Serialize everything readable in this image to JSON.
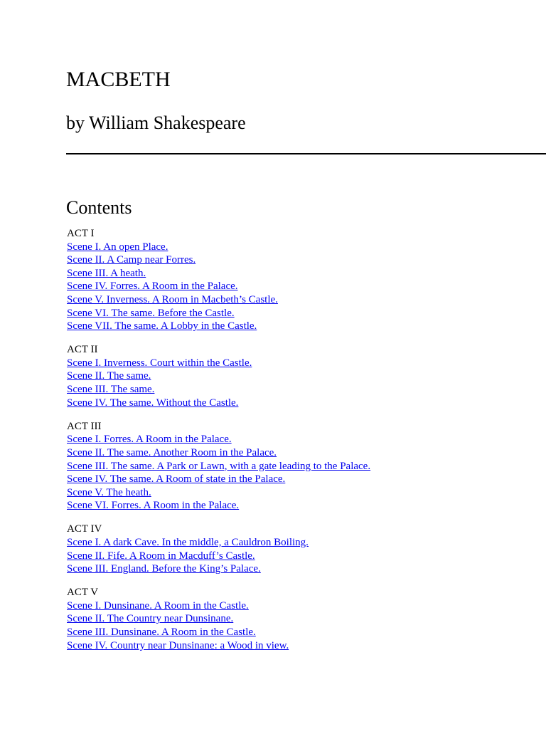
{
  "title": "MACBETH",
  "author": "by William Shakespeare",
  "contents_heading": "Contents",
  "link_color": "#0000ee",
  "acts": [
    {
      "label": "ACT I",
      "scenes": [
        "Scene I. An open Place.",
        "Scene II. A Camp near Forres.",
        "Scene III. A heath.",
        "Scene IV. Forres. A Room in the Palace.",
        "Scene V. Inverness. A Room in Macbeth’s Castle.",
        "Scene VI. The same. Before the Castle.",
        "Scene VII. The same. A Lobby in the Castle."
      ]
    },
    {
      "label": "ACT II",
      "scenes": [
        "Scene I. Inverness. Court within the Castle.",
        "Scene II. The same.",
        "Scene III. The same.",
        "Scene IV. The same. Without the Castle."
      ]
    },
    {
      "label": "ACT III",
      "scenes": [
        "Scene I. Forres. A Room in the Palace.",
        "Scene II. The same. Another Room in the Palace.",
        "Scene III. The same. A Park or Lawn, with a gate leading to the Palace.",
        "Scene IV. The same. A Room of state in the Palace.",
        "Scene V. The heath.",
        "Scene VI. Forres. A Room in the Palace."
      ]
    },
    {
      "label": "ACT IV",
      "scenes": [
        "Scene I. A dark Cave. In the middle, a Cauldron Boiling.",
        "Scene II. Fife. A Room in Macduff’s Castle.",
        "Scene III. England. Before the King’s Palace."
      ]
    },
    {
      "label": "ACT V",
      "scenes": [
        "Scene I. Dunsinane. A Room in the Castle.",
        "Scene II. The Country near Dunsinane.",
        "Scene III. Dunsinane. A Room in the Castle.",
        "Scene IV. Country near Dunsinane: a Wood in view."
      ]
    }
  ]
}
